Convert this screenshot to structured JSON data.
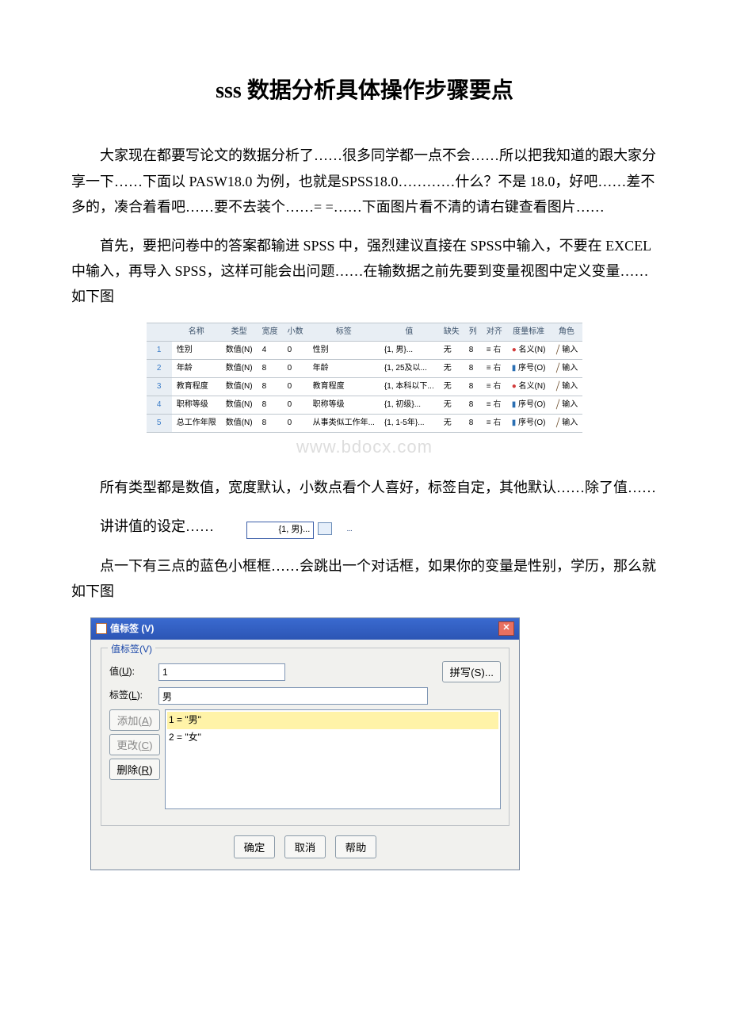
{
  "title": "sss 数据分析具体操作步骤要点",
  "p1": "大家现在都要写论文的数据分析了……很多同学都一点不会……所以把我知道的跟大家分享一下……下面以 PASW18.0 为例，也就是SPSS18.0…………什么？不是 18.0，好吧……差不多的，凑合着看吧……要不去装个……= =……下面图片看不清的请右键查看图片……",
  "p2": "首先，要把问卷中的答案都输进 SPSS 中，强烈建议直接在 SPSS中输入，不要在 EXCEL 中输入，再导入 SPSS，这样可能会出问题……在输数据之前先要到变量视图中定义变量……如下图",
  "var_headers": [
    "",
    "名称",
    "类型",
    "宽度",
    "小数",
    "标签",
    "值",
    "缺失",
    "列",
    "对齐",
    "度量标准",
    "角色"
  ],
  "var_rows": [
    {
      "n": "1",
      "name": "性别",
      "type": "数值(N)",
      "w": "4",
      "d": "0",
      "lbl": "性别",
      "val": "{1, 男}...",
      "miss": "无",
      "col": "8",
      "align": "右",
      "meas": "名义(N)",
      "role": "输入",
      "meas_icon": "nominal"
    },
    {
      "n": "2",
      "name": "年龄",
      "type": "数值(N)",
      "w": "8",
      "d": "0",
      "lbl": "年龄",
      "val": "{1, 25及以...",
      "miss": "无",
      "col": "8",
      "align": "右",
      "meas": "序号(O)",
      "role": "输入",
      "meas_icon": "ordinal"
    },
    {
      "n": "3",
      "name": "教育程度",
      "type": "数值(N)",
      "w": "8",
      "d": "0",
      "lbl": "教育程度",
      "val": "{1, 本科以下...",
      "miss": "无",
      "col": "8",
      "align": "右",
      "meas": "名义(N)",
      "role": "输入",
      "meas_icon": "nominal"
    },
    {
      "n": "4",
      "name": "职称等级",
      "type": "数值(N)",
      "w": "8",
      "d": "0",
      "lbl": "职称等级",
      "val": "{1, 初级}...",
      "miss": "无",
      "col": "8",
      "align": "右",
      "meas": "序号(O)",
      "role": "输入",
      "meas_icon": "ordinal"
    },
    {
      "n": "5",
      "name": "总工作年限",
      "type": "数值(N)",
      "w": "8",
      "d": "0",
      "lbl": "从事类似工作年...",
      "val": "{1, 1-5年}...",
      "miss": "无",
      "col": "8",
      "align": "右",
      "meas": "序号(O)",
      "role": "输入",
      "meas_icon": "ordinal"
    }
  ],
  "align_prefix": "≡",
  "nominal_glyph": "●",
  "ordinal_glyph": "▮",
  "role_glyph": "╲",
  "p3": "所有类型都是数值，宽度默认，小数点看个人喜好，标签自定，其他默认……除了值……",
  "p4_pre": "讲讲值的设定……",
  "chip_text": "{1, 男}...",
  "chip_btn": "...",
  "p5": "点一下有三点的蓝色小框框……会跳出一个对话框，如果你的变量是性别，学历，那么就如下图",
  "watermark": "www.bdocx.com",
  "dialog": {
    "title": "值标签 (V)",
    "close": "✕",
    "legend": "值标签(V)",
    "value_lbl_pre": "值(",
    "value_lbl_u": "U",
    "value_lbl_post": "):",
    "value_val": "1",
    "spell": "拼写(S)...",
    "label_lbl_pre": "标签(",
    "label_lbl_u": "L",
    "label_lbl_post": "):",
    "label_val": "男",
    "list_sel": "1 = \"男\"",
    "list_2": "2 = \"女\"",
    "add_pre": "添加(",
    "add_u": "A",
    "add_post": ")",
    "chg_pre": "更改(",
    "chg_u": "C",
    "chg_post": ")",
    "del_pre": "删除(",
    "del_u": "R",
    "del_post": ")",
    "ok": "确定",
    "cancel": "取消",
    "help": "帮助"
  }
}
